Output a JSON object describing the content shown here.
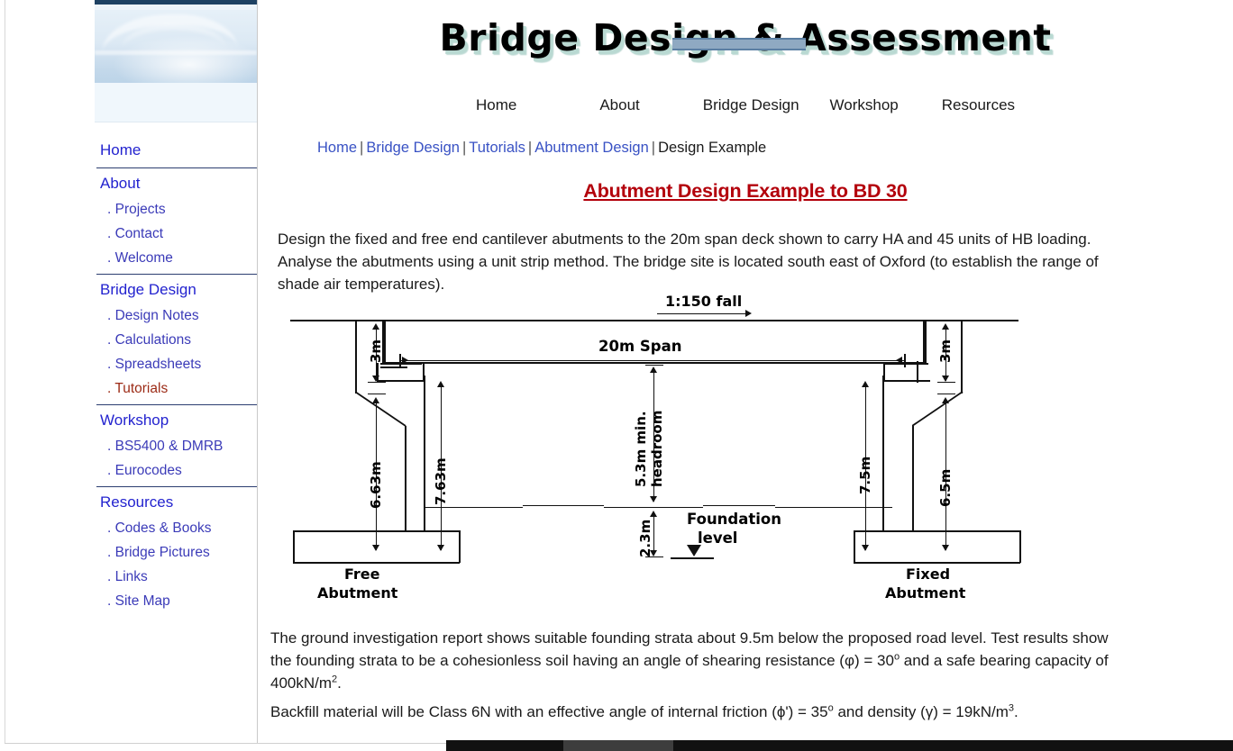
{
  "site": {
    "title": "Bridge Design & Assessment"
  },
  "topnav": {
    "items": [
      {
        "label": "Home"
      },
      {
        "label": "About"
      },
      {
        "label": "Bridge Design"
      },
      {
        "label": "Workshop"
      },
      {
        "label": "Resources"
      }
    ]
  },
  "sidebar": {
    "groups": [
      {
        "top": "Home",
        "items": []
      },
      {
        "top": "About",
        "items": [
          {
            "label": ". Projects",
            "current": false
          },
          {
            "label": ". Contact",
            "current": false
          },
          {
            "label": ". Welcome",
            "current": false
          }
        ]
      },
      {
        "top": "Bridge Design",
        "items": [
          {
            "label": ". Design Notes",
            "current": false
          },
          {
            "label": ". Calculations",
            "current": false
          },
          {
            "label": ". Spreadsheets",
            "current": false
          },
          {
            "label": ". Tutorials",
            "current": true
          }
        ]
      },
      {
        "top": "Workshop",
        "items": [
          {
            "label": ". BS5400 & DMRB",
            "current": false
          },
          {
            "label": ". Eurocodes",
            "current": false
          }
        ]
      },
      {
        "top": "Resources",
        "items": [
          {
            "label": ". Codes & Books",
            "current": false
          },
          {
            "label": ". Bridge Pictures",
            "current": false
          },
          {
            "label": ". Links",
            "current": false
          },
          {
            "label": ". Site Map",
            "current": false
          }
        ]
      }
    ]
  },
  "breadcrumb": {
    "item1": "Home",
    "sep1": "|",
    "item2": "Bridge Design",
    "sep2": "|",
    "item3": "Tutorials",
    "sep3": "|",
    "item4": "Abutment Design",
    "sep4": "|",
    "current": "Design Example"
  },
  "heading": "Abutment Design Example to BD 30",
  "paragraphs": {
    "intro": "Design the fixed and free end cantilever abutments to the 20m span deck shown to carry HA and 45 units of HB loading. Analyse the abutments using a unit strip method. The bridge site is located south east of Oxford (to establish the range of shade air temperatures).",
    "ground_1": "The ground investigation report shows suitable founding strata about 9.5m below the proposed road level. Test results show the founding strata to be a cohesionless soil having an angle of shearing resistance (φ) = 30",
    "ground_sup1": "o",
    "ground_2": " and a safe bearing capacity of 400kN/m",
    "ground_sup2": "2",
    "ground_3": ".",
    "backfill_1": "Backfill material will be Class 6N with an effective angle of internal friction (ϕ') = 35",
    "backfill_sup1": "o",
    "backfill_2": " and density (γ) = 19kN/m",
    "backfill_sup2": "3",
    "backfill_3": "."
  },
  "diagram": {
    "alt": "Elevation of 20m span bridge with free and fixed cantilever abutments",
    "labels": {
      "fall": "1:150 fall",
      "span": "20m Span",
      "height_left_top": "3m",
      "height_right_top": "3m",
      "free_abutment_height": "6.63m",
      "free_total_height": "7.63m",
      "fixed_total_height": "7.5m",
      "fixed_abutment_height": "6.5m",
      "headroom": "5.3m min. headroom",
      "foundation_depth": "2.3m",
      "foundation_level_1": "Foundation",
      "foundation_level_2": "level",
      "free_abutment_1": "Free",
      "free_abutment_2": "Abutment",
      "fixed_abutment_1": "Fixed",
      "fixed_abutment_2": "Abutment"
    }
  },
  "colors": {
    "link": "#3952c4",
    "sidebar_top": "#2323cf",
    "sidebar_sub": "#3b3bb8",
    "sidebar_current": "#9c2b16",
    "heading": "#b3000b",
    "divider": "#2c3e70"
  }
}
